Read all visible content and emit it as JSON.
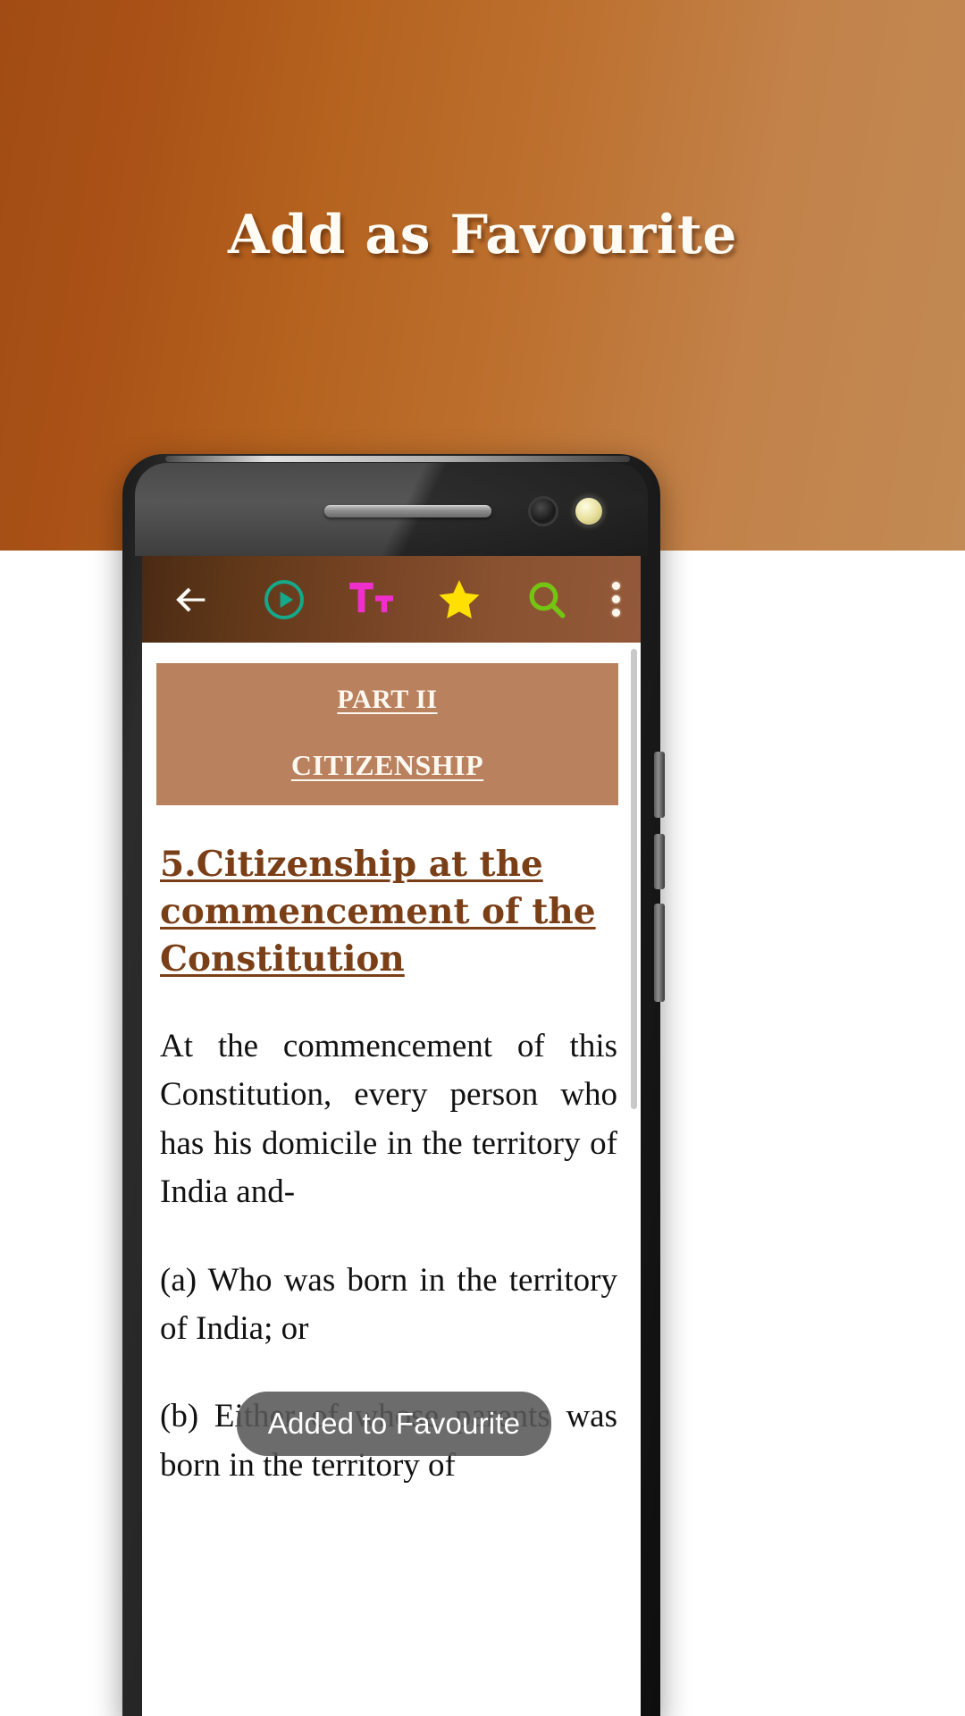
{
  "banner": {
    "title": "Add as Favourite",
    "gradient_from": "#a14c14",
    "gradient_to": "#c28a54"
  },
  "phone": {
    "frame_color": "#1b1b1b",
    "hardware": {
      "speaker_label": "earpiece-speaker",
      "front_camera_label": "front-camera",
      "sensor_label": "proximity-sensor"
    }
  },
  "app": {
    "toolbar": {
      "background_from": "#4a2a14",
      "background_to": "#93593a",
      "items": [
        {
          "name": "back",
          "icon": "back-arrow-icon",
          "color": "#fdfbf6"
        },
        {
          "name": "play",
          "icon": "play-circle-icon",
          "color": "#15a88a"
        },
        {
          "name": "text-size",
          "icon": "text-size-icon",
          "label": "Tt",
          "color": "#ef2fcb"
        },
        {
          "name": "favourite",
          "icon": "star-icon",
          "color": "#ffe000"
        },
        {
          "name": "search",
          "icon": "search-icon",
          "color": "#73c413"
        },
        {
          "name": "overflow",
          "icon": "more-vertical-icon",
          "color": "#fdf6ec"
        }
      ]
    },
    "content": {
      "part_banner": {
        "background": "#b9815e",
        "line1": "PART II",
        "line2": "CITIZENSHIP"
      },
      "section_heading": "5.Citizenship at the commencement of the Constitution",
      "section_heading_color": "#7a3f17",
      "paragraphs": [
        "At the commencement of this Constitution, every person who has his domicile in the territory of India and-",
        "(a) Who was born in the territory of India; or",
        "(b) Either of whose parents was born in the territory of"
      ]
    },
    "toast": {
      "message": "Added to Favourite",
      "background": "rgba(88,88,88,0.88)",
      "text_color": "#ffffff"
    }
  }
}
